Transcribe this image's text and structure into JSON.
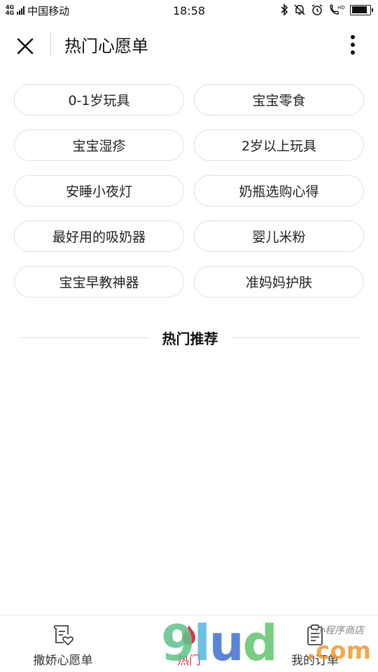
{
  "status_bar": {
    "network": "4G",
    "carrier": "中国移动",
    "time": "18:58",
    "icons": [
      "bluetooth-icon",
      "mute-icon",
      "alarm-icon",
      "hd-call-icon",
      "battery-icon"
    ],
    "battery_level": 0.85
  },
  "header": {
    "title": "热门心愿单",
    "close_icon": "close-icon",
    "more_icon": "more-vertical-icon"
  },
  "tags": [
    {
      "label": "0-1岁玩具"
    },
    {
      "label": "宝宝零食"
    },
    {
      "label": "宝宝湿疹"
    },
    {
      "label": "2岁以上玩具"
    },
    {
      "label": "安睡小夜灯"
    },
    {
      "label": "奶瓶选购心得"
    },
    {
      "label": "最好用的吸奶器"
    },
    {
      "label": "婴儿米粉"
    },
    {
      "label": "宝宝早教神器"
    },
    {
      "label": "准妈妈护肤"
    }
  ],
  "section": {
    "title": "热门推荐"
  },
  "bottom_nav": {
    "items": [
      {
        "label": "撒娇心愿单",
        "icon": "wishlist-icon",
        "active": false
      },
      {
        "label": "热门",
        "icon": "flame-icon",
        "active": true
      },
      {
        "label": "我的订单",
        "icon": "clipboard-icon",
        "active": false
      }
    ]
  },
  "watermark": {
    "brand": "9lud",
    "domain": ".com",
    "tagline": "小程序商店"
  },
  "colors": {
    "accent": "#e0304a",
    "border": "#e1e1e1",
    "text": "#222222"
  }
}
